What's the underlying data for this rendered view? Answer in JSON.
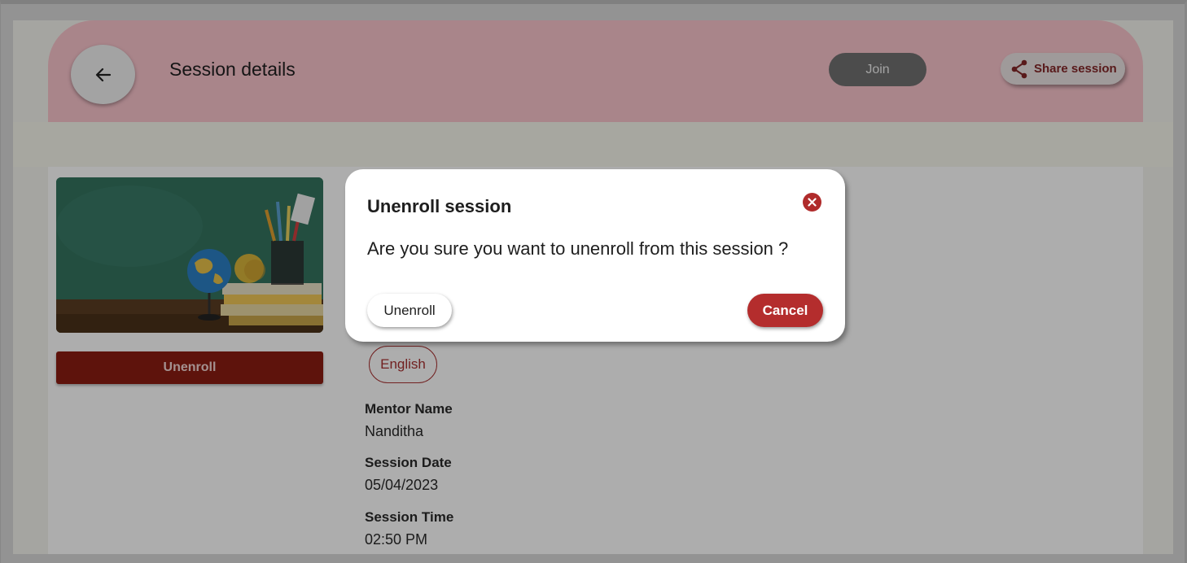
{
  "header": {
    "title": "Session details",
    "join_label": "Join",
    "share_label": "Share session"
  },
  "session": {
    "image_alt": "Globe, apple, books and pencil holder on a desk",
    "unenroll_label": "Unenroll",
    "language": "English",
    "fields": [
      {
        "label": "Mentor Name",
        "value": "Nanditha"
      },
      {
        "label": "Session Date",
        "value": "05/04/2023"
      },
      {
        "label": "Session Time",
        "value": "02:50 PM"
      }
    ]
  },
  "modal": {
    "title": "Unenroll session",
    "message": "Are you sure you want to unenroll from this session ?",
    "confirm_label": "Unenroll",
    "cancel_label": "Cancel"
  },
  "colors": {
    "header_bg": "#f9c4cc",
    "brand_dark_red": "#8b1d12",
    "accent_red": "#b42d2d",
    "join_bg": "#717171"
  },
  "icons": {
    "back": "arrow-left-icon",
    "share": "share-icon",
    "close": "close-circle-icon"
  }
}
